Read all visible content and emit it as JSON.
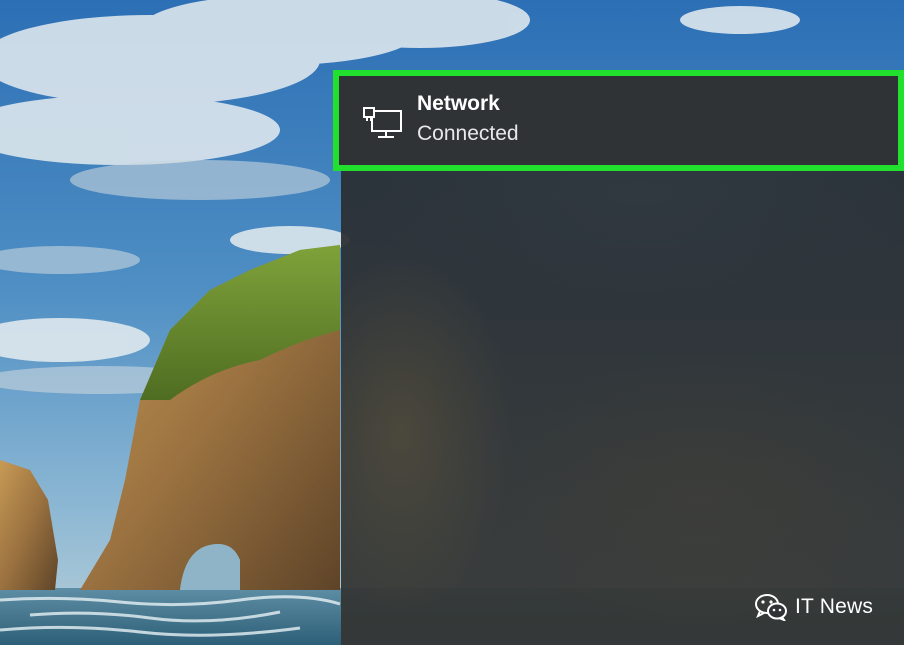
{
  "network_tile": {
    "name": "Network",
    "status": "Connected",
    "icon": "ethernet-monitor-icon"
  },
  "watermark": {
    "text": "IT News",
    "icon": "wechat-icon"
  },
  "colors": {
    "highlight_border": "#22e02e",
    "flyout_background": "#2f3336",
    "text": "#ffffff"
  }
}
